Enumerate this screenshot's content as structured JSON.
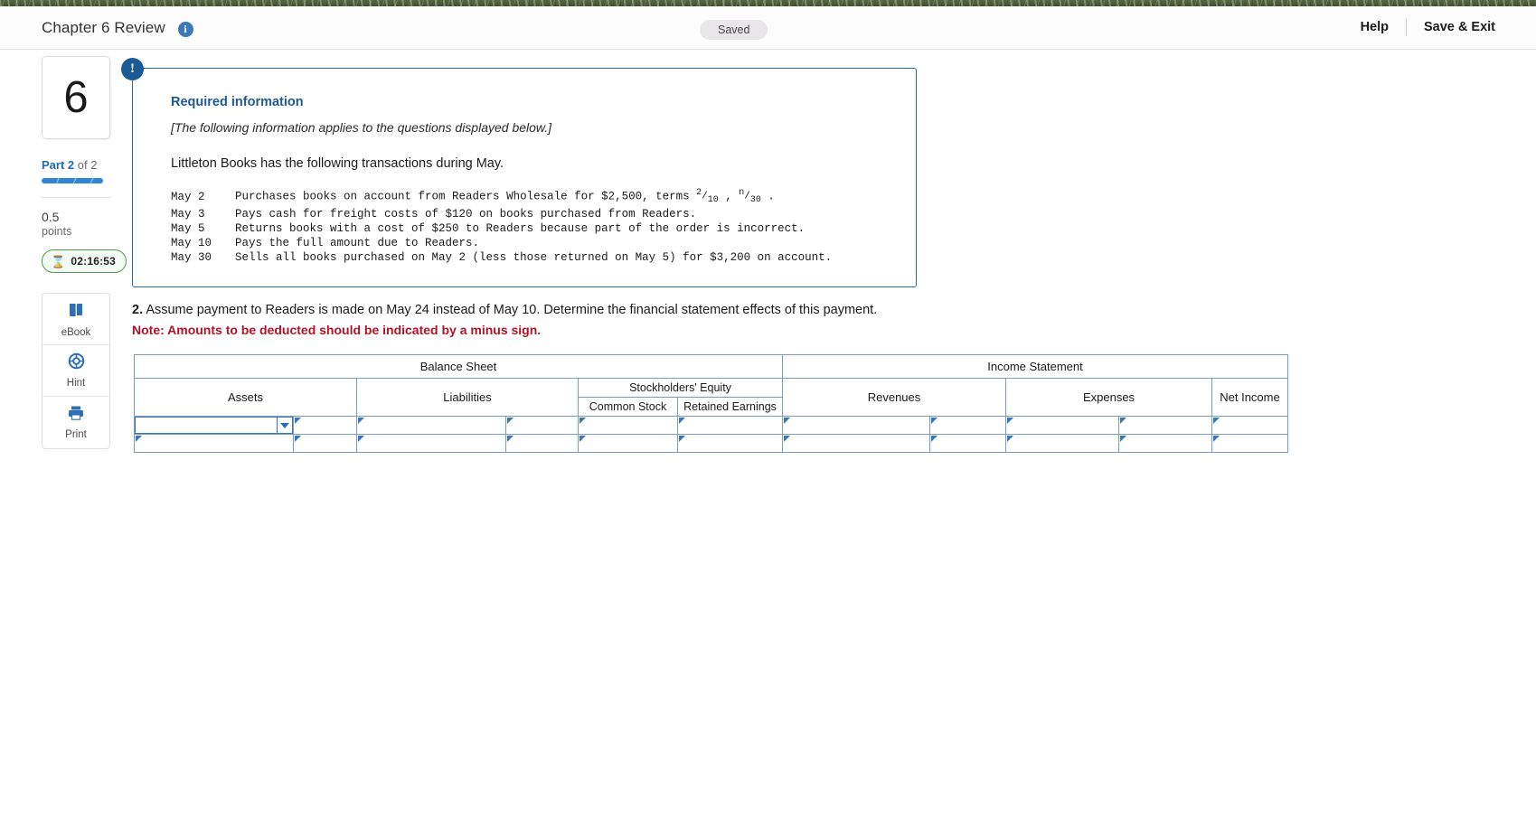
{
  "header": {
    "title": "Chapter 6 Review",
    "info_icon": "info-icon",
    "saved_status": "Saved",
    "help_label": "Help",
    "save_exit_label": "Save & Exit"
  },
  "sidebar": {
    "question_number": "6",
    "part_prefix": "Part",
    "part_current": "2",
    "part_of": "of 2",
    "points_value": "0.5",
    "points_word": "points",
    "timer": "02:16:53",
    "timer_icon": "hourglass-icon",
    "tools": [
      {
        "label": "eBook",
        "icon": "book-icon"
      },
      {
        "label": "Hint",
        "icon": "lifering-icon"
      },
      {
        "label": "Print",
        "icon": "printer-icon"
      }
    ]
  },
  "required_info": {
    "badge": "!",
    "title": "Required information",
    "subtitle": "[The following information applies to the questions displayed below.]",
    "lead": "Littleton Books has the following transactions during May.",
    "transactions": [
      {
        "date": "May 2",
        "desc_before": "Purchases books on account from Readers Wholesale for $2,500, terms ",
        "frac1_num": "2",
        "frac1_den": "10",
        "desc_mid": " , ",
        "frac2_num": "n",
        "frac2_den": "30",
        "desc_after": " ."
      },
      {
        "date": "May 3",
        "desc_before": "Pays cash for freight costs of $120 on books purchased from Readers.",
        "frac1_num": "",
        "frac1_den": "",
        "desc_mid": "",
        "frac2_num": "",
        "frac2_den": "",
        "desc_after": ""
      },
      {
        "date": "May 5",
        "desc_before": "Returns books with a cost of $250 to Readers because part of the order is incorrect.",
        "frac1_num": "",
        "frac1_den": "",
        "desc_mid": "",
        "frac2_num": "",
        "frac2_den": "",
        "desc_after": ""
      },
      {
        "date": "May 10",
        "desc_before": "Pays the full amount due to Readers.",
        "frac1_num": "",
        "frac1_den": "",
        "desc_mid": "",
        "frac2_num": "",
        "frac2_den": "",
        "desc_after": ""
      },
      {
        "date": "May 30",
        "desc_before": "Sells all books purchased on May 2 (less those returned on May 5) for $3,200 on account.",
        "frac1_num": "",
        "frac1_den": "",
        "desc_mid": "",
        "frac2_num": "",
        "frac2_den": "",
        "desc_after": ""
      }
    ]
  },
  "question": {
    "number": "2.",
    "text": " Assume payment to Readers is made on May 24 instead of May 10. Determine the financial statement effects of this payment.",
    "note": "Note: Amounts to be deducted should be indicated by a minus sign."
  },
  "fin_table": {
    "group_balance_sheet": "Balance Sheet",
    "group_income_statement": "Income Statement",
    "col_assets": "Assets",
    "col_liabilities": "Liabilities",
    "col_stockholders_equity": "Stockholders' Equity",
    "col_common_stock": "Common Stock",
    "col_retained_earnings": "Retained Earnings",
    "col_revenues": "Revenues",
    "col_expenses": "Expenses",
    "col_net_income": "Net Income",
    "row1": {
      "assets_select": "",
      "assets_amount": "",
      "liabilities_label": "",
      "liabilities_amount": "",
      "common_stock": "",
      "retained_earnings": "",
      "revenues_label": "",
      "revenues_amount": "",
      "expenses_label": "",
      "expenses_amount": "",
      "net_income": ""
    },
    "row2": {
      "assets_select": "",
      "assets_amount": "",
      "liabilities_label": "",
      "liabilities_amount": "",
      "common_stock": "",
      "retained_earnings": "",
      "revenues_label": "",
      "revenues_amount": "",
      "expenses_label": "",
      "expenses_amount": "",
      "net_income": ""
    }
  },
  "colors": {
    "accent_blue": "#1c5a96",
    "header_cell_blue": "#74a9e0",
    "note_red": "#b11226",
    "timer_green": "#4f9a4f"
  }
}
